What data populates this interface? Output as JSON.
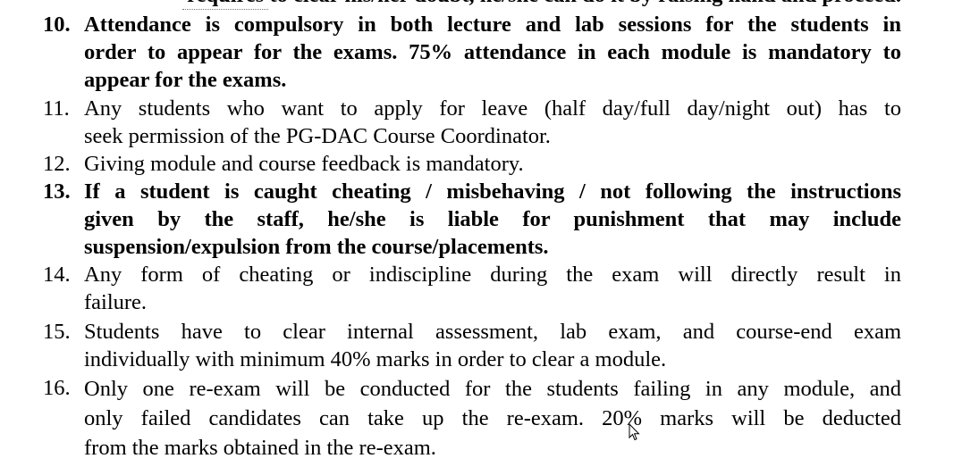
{
  "document": {
    "top_partial": "requires to clear his/her doubt, he/she can do it by raising hand and proceed.",
    "items": [
      {
        "number": "10.",
        "bold": true,
        "lines": [
          "Attendance is compulsory in both lecture and lab sessions for the students in",
          "order to appear for the exams. 75% attendance in each module is mandatory to",
          "appear for the exams."
        ]
      },
      {
        "number": "11.",
        "bold": false,
        "lines": [
          "Any students who want to apply for leave (half day/full day/night out) has to",
          "seek permission of the PG-DAC Course Coordinator."
        ]
      },
      {
        "number": "12.",
        "bold": false,
        "lines": [
          "Giving module and course feedback is mandatory."
        ]
      },
      {
        "number": "13.",
        "bold": true,
        "lines": [
          "If a student is caught cheating / misbehaving / not following the instructions",
          "given by the staff, he/she is liable for punishment that may include",
          "suspension/expulsion from the course/placements."
        ]
      },
      {
        "number": "14.",
        "bold": false,
        "lines": [
          "Any form of cheating or indiscipline during the exam will directly result in",
          "failure."
        ]
      },
      {
        "number": "15.",
        "bold": false,
        "lines": [
          "Students have to clear internal assessment, lab exam, and course-end exam",
          "individually with minimum 40% marks in order to clear a module."
        ]
      },
      {
        "number": "16.",
        "bold": false,
        "lines": [
          "Only one re-exam will be conducted for the students failing in any module, and",
          "only failed candidates can take up the re-exam. 20% marks will be deducted",
          "from the marks obtained in the re-exam."
        ]
      }
    ]
  },
  "icons": {
    "cursor": "mouse-pointer-icon"
  }
}
